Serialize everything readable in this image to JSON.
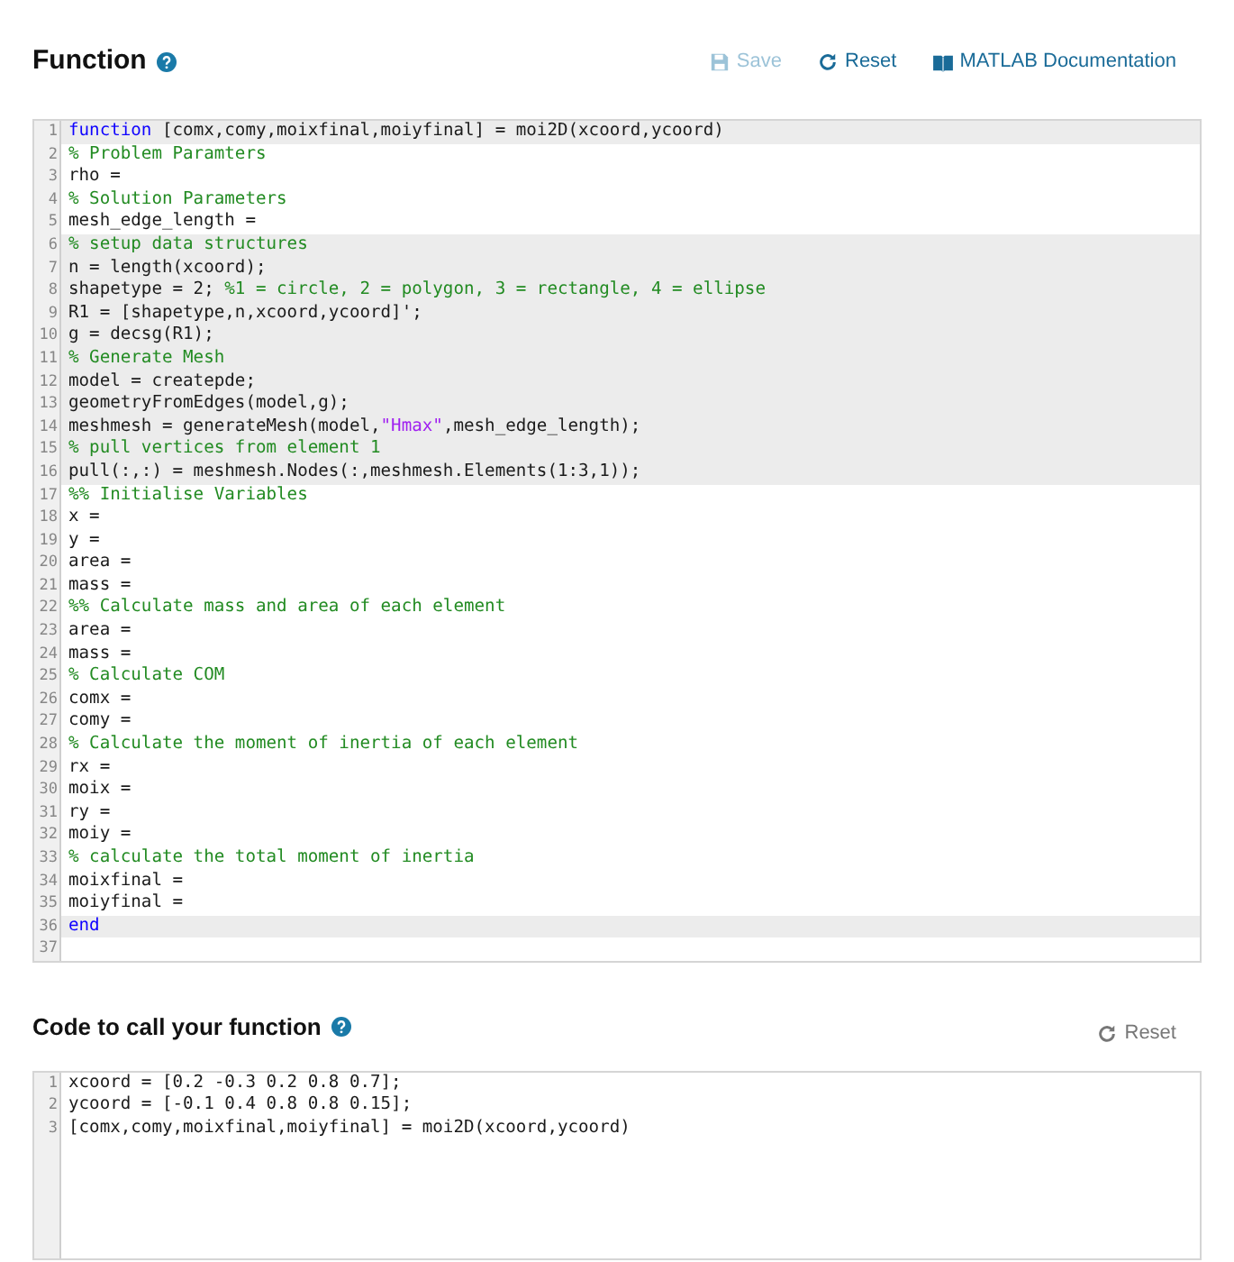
{
  "function_section": {
    "title": "Function",
    "actions": [
      {
        "kind": "save",
        "label": "Save",
        "disabled": true
      },
      {
        "kind": "reset",
        "label": "Reset",
        "disabled": false
      },
      {
        "kind": "docs",
        "label": "MATLAB Documentation",
        "disabled": false
      }
    ],
    "editor": {
      "lines": [
        {
          "number": "1",
          "locked": true,
          "tokens": [
            {
              "kind": "keyword",
              "text": "function"
            },
            {
              "kind": "code",
              "text": " [comx,comy,moixfinal,moiyfinal] = moi2D(xcoord,ycoord)"
            }
          ]
        },
        {
          "number": "2",
          "locked": false,
          "tokens": [
            {
              "kind": "comment",
              "text": "% Problem Paramters"
            }
          ]
        },
        {
          "number": "3",
          "locked": false,
          "tokens": [
            {
              "kind": "code",
              "text": "rho ="
            }
          ]
        },
        {
          "number": "4",
          "locked": false,
          "tokens": [
            {
              "kind": "comment",
              "text": "% Solution Parameters"
            }
          ]
        },
        {
          "number": "5",
          "locked": false,
          "tokens": [
            {
              "kind": "code",
              "text": "mesh_edge_length ="
            }
          ]
        },
        {
          "number": "6",
          "locked": true,
          "tokens": [
            {
              "kind": "comment",
              "text": "% setup data structures"
            }
          ]
        },
        {
          "number": "7",
          "locked": true,
          "tokens": [
            {
              "kind": "code",
              "text": "n = length(xcoord);"
            }
          ]
        },
        {
          "number": "8",
          "locked": true,
          "tokens": [
            {
              "kind": "code",
              "text": "shapetype = 2; "
            },
            {
              "kind": "comment",
              "text": "%1 = circle, 2 = polygon, 3 = rectangle, 4 = ellipse"
            }
          ]
        },
        {
          "number": "9",
          "locked": true,
          "tokens": [
            {
              "kind": "code",
              "text": "R1 = [shapetype,n,xcoord,ycoord]';"
            }
          ]
        },
        {
          "number": "10",
          "locked": true,
          "tokens": [
            {
              "kind": "code",
              "text": "g = decsg(R1);"
            }
          ]
        },
        {
          "number": "11",
          "locked": true,
          "tokens": [
            {
              "kind": "comment",
              "text": "% Generate Mesh"
            }
          ]
        },
        {
          "number": "12",
          "locked": true,
          "tokens": [
            {
              "kind": "code",
              "text": "model = createpde;"
            }
          ]
        },
        {
          "number": "13",
          "locked": true,
          "tokens": [
            {
              "kind": "code",
              "text": "geometryFromEdges(model,g);"
            }
          ]
        },
        {
          "number": "14",
          "locked": true,
          "tokens": [
            {
              "kind": "code",
              "text": "meshmesh = generateMesh(model,"
            },
            {
              "kind": "string",
              "text": "\"Hmax\""
            },
            {
              "kind": "code",
              "text": ",mesh_edge_length);"
            }
          ]
        },
        {
          "number": "15",
          "locked": true,
          "tokens": [
            {
              "kind": "comment",
              "text": "% pull vertices from element 1"
            }
          ]
        },
        {
          "number": "16",
          "locked": true,
          "tokens": [
            {
              "kind": "code",
              "text": "pull(:,:) = meshmesh.Nodes(:,meshmesh.Elements(1:3,1));"
            }
          ]
        },
        {
          "number": "17",
          "locked": false,
          "tokens": [
            {
              "kind": "comment",
              "text": "%% Initialise Variables"
            }
          ]
        },
        {
          "number": "18",
          "locked": false,
          "tokens": [
            {
              "kind": "code",
              "text": "x ="
            }
          ]
        },
        {
          "number": "19",
          "locked": false,
          "tokens": [
            {
              "kind": "code",
              "text": "y ="
            }
          ]
        },
        {
          "number": "20",
          "locked": false,
          "tokens": [
            {
              "kind": "code",
              "text": "area ="
            }
          ]
        },
        {
          "number": "21",
          "locked": false,
          "tokens": [
            {
              "kind": "code",
              "text": "mass ="
            }
          ]
        },
        {
          "number": "22",
          "locked": false,
          "tokens": [
            {
              "kind": "comment",
              "text": "%% Calculate mass and area of each element"
            }
          ]
        },
        {
          "number": "23",
          "locked": false,
          "tokens": [
            {
              "kind": "code",
              "text": "area ="
            }
          ]
        },
        {
          "number": "24",
          "locked": false,
          "tokens": [
            {
              "kind": "code",
              "text": "mass ="
            }
          ]
        },
        {
          "number": "25",
          "locked": false,
          "tokens": [
            {
              "kind": "comment",
              "text": "% Calculate COM"
            }
          ]
        },
        {
          "number": "26",
          "locked": false,
          "tokens": [
            {
              "kind": "code",
              "text": "comx ="
            }
          ]
        },
        {
          "number": "27",
          "locked": false,
          "tokens": [
            {
              "kind": "code",
              "text": "comy ="
            }
          ]
        },
        {
          "number": "28",
          "locked": false,
          "tokens": [
            {
              "kind": "comment",
              "text": "% Calculate the moment of inertia of each element"
            }
          ]
        },
        {
          "number": "29",
          "locked": false,
          "tokens": [
            {
              "kind": "code",
              "text": "rx ="
            }
          ]
        },
        {
          "number": "30",
          "locked": false,
          "tokens": [
            {
              "kind": "code",
              "text": "moix ="
            }
          ]
        },
        {
          "number": "31",
          "locked": false,
          "tokens": [
            {
              "kind": "code",
              "text": "ry ="
            }
          ]
        },
        {
          "number": "32",
          "locked": false,
          "tokens": [
            {
              "kind": "code",
              "text": "moiy ="
            }
          ]
        },
        {
          "number": "33",
          "locked": false,
          "tokens": [
            {
              "kind": "comment",
              "text": "% calculate the total moment of inertia"
            }
          ]
        },
        {
          "number": "34",
          "locked": false,
          "tokens": [
            {
              "kind": "code",
              "text": "moixfinal ="
            }
          ]
        },
        {
          "number": "35",
          "locked": false,
          "tokens": [
            {
              "kind": "code",
              "text": "moiyfinal ="
            }
          ]
        },
        {
          "number": "36",
          "locked": true,
          "tokens": [
            {
              "kind": "keyword",
              "text": "end"
            }
          ]
        },
        {
          "number": "37"
        }
      ]
    }
  },
  "call_section": {
    "title": "Code to call your function",
    "actions": [
      {
        "kind": "reset",
        "label": "Reset",
        "disabled": true
      }
    ],
    "editor": {
      "lines": [
        {
          "number": "1",
          "locked": false,
          "tokens": [
            {
              "kind": "code",
              "text": "xcoord = [0.2 -0.3 0.2 0.8 0.7];"
            }
          ]
        },
        {
          "number": "2",
          "locked": false,
          "tokens": [
            {
              "kind": "code",
              "text": "ycoord = [-0.1 0.4 0.8 0.8 0.15];"
            }
          ]
        },
        {
          "number": "3",
          "locked": false,
          "tokens": [
            {
              "kind": "code",
              "text": "[comx,comy,moixfinal,moiyfinal] = moi2D(xcoord,ycoord)"
            }
          ]
        }
      ]
    }
  }
}
